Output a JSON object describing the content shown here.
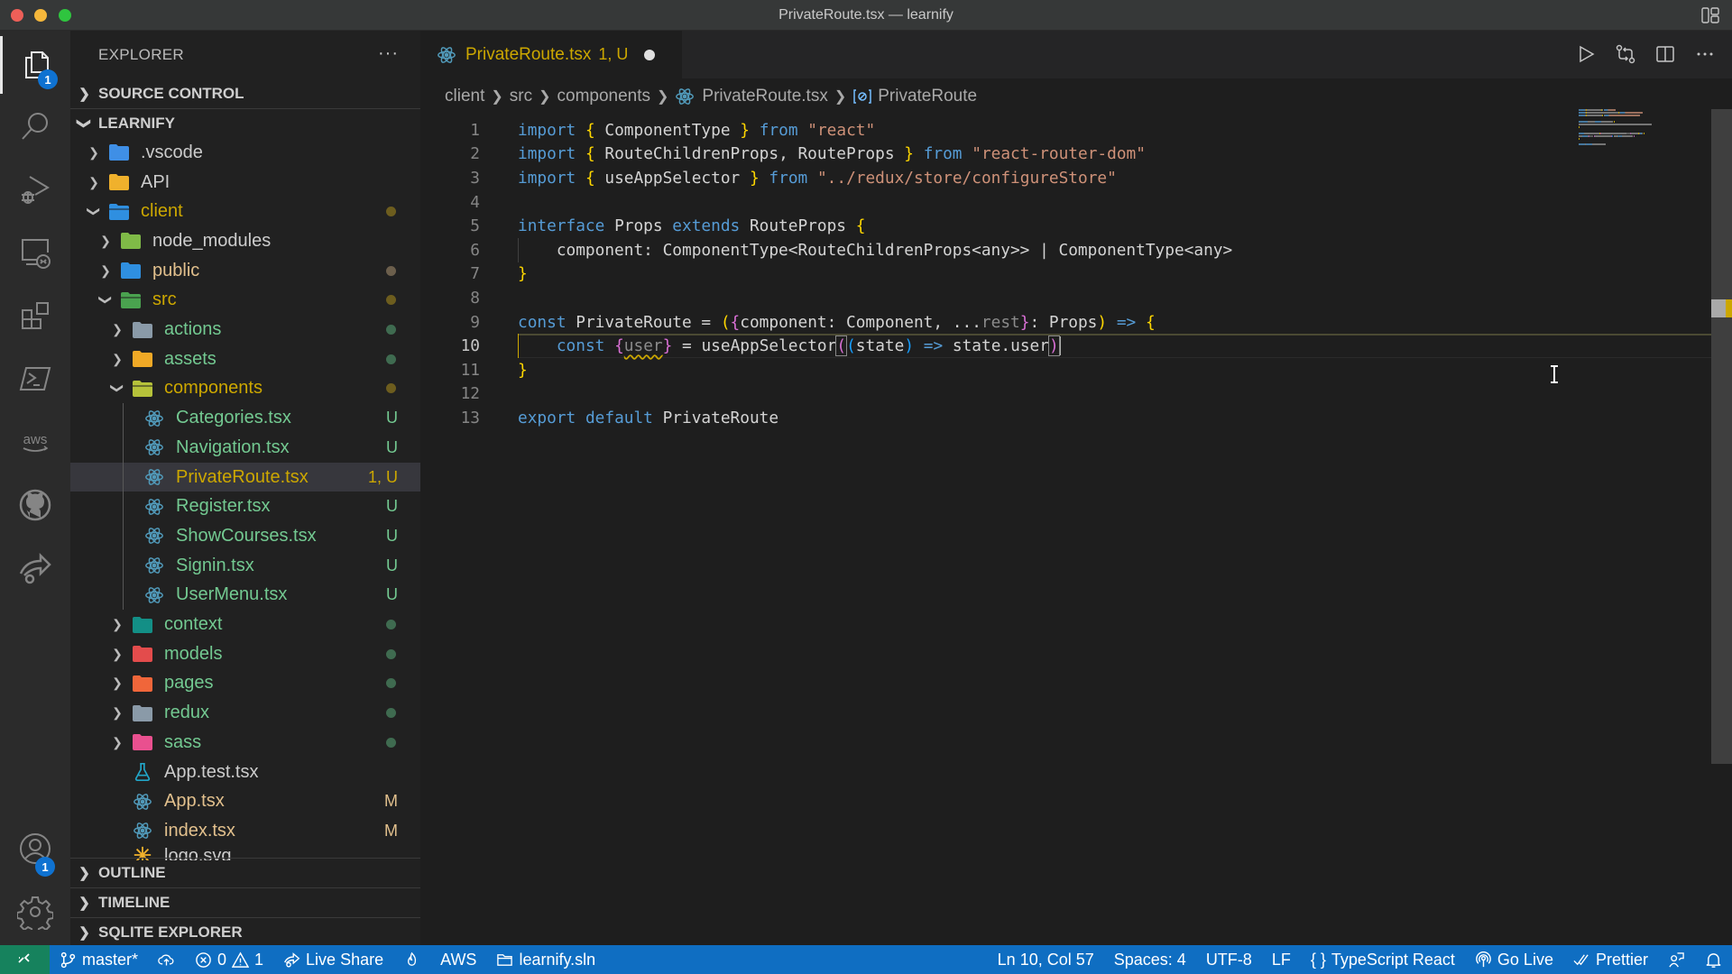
{
  "window": {
    "title": "PrivateRoute.tsx — learnify"
  },
  "activity_bar": {
    "items": [
      {
        "name": "explorer",
        "icon": "files-icon",
        "badge": "1",
        "active": true
      },
      {
        "name": "search",
        "icon": "search-icon"
      },
      {
        "name": "run-debug",
        "icon": "run-debug-icon"
      },
      {
        "name": "remote-explorer",
        "icon": "remote-explorer-icon"
      },
      {
        "name": "extensions",
        "icon": "extensions-icon"
      },
      {
        "name": "powershell",
        "icon": "terminal-icon"
      },
      {
        "name": "aws",
        "icon": "aws-icon",
        "text": "aws"
      },
      {
        "name": "github",
        "icon": "github-icon"
      },
      {
        "name": "live-share",
        "icon": "live-share-icon"
      }
    ],
    "accounts_badge": "1"
  },
  "sidebar": {
    "title": "EXPLORER",
    "more": "···",
    "sections": {
      "source_control": "SOURCE CONTROL",
      "workspace": "LEARNIFY",
      "outline": "OUTLINE",
      "timeline": "TIMELINE",
      "sqlite": "SQLITE EXPLORER"
    },
    "tree": [
      {
        "label": ".vscode",
        "type": "folder",
        "expanded": false,
        "depth": 0,
        "icon": "vscode-folder-icon",
        "color": "#cccccc",
        "decoration": ""
      },
      {
        "label": "API",
        "type": "folder",
        "expanded": false,
        "depth": 0,
        "icon": "api-folder-icon",
        "color": "#cccccc",
        "decoration": ""
      },
      {
        "label": "client",
        "type": "folder",
        "expanded": true,
        "depth": 0,
        "icon": "client-folder-icon",
        "color": "#cca700",
        "decoration": "dot-yellow"
      },
      {
        "label": "node_modules",
        "type": "folder",
        "expanded": false,
        "depth": 1,
        "icon": "node-folder-icon",
        "color": "#cccccc",
        "decoration": ""
      },
      {
        "label": "public",
        "type": "folder",
        "expanded": false,
        "depth": 1,
        "icon": "public-folder-icon",
        "color": "#e2c08d",
        "decoration": "dot-brown"
      },
      {
        "label": "src",
        "type": "folder",
        "expanded": true,
        "depth": 1,
        "icon": "src-folder-icon",
        "color": "#cca700",
        "decoration": "dot-yellow"
      },
      {
        "label": "actions",
        "type": "folder",
        "expanded": false,
        "depth": 2,
        "icon": "actions-folder-icon",
        "color": "#73c991",
        "decoration": "dot-green"
      },
      {
        "label": "assets",
        "type": "folder",
        "expanded": false,
        "depth": 2,
        "icon": "assets-folder-icon",
        "color": "#73c991",
        "decoration": "dot-green"
      },
      {
        "label": "components",
        "type": "folder",
        "expanded": true,
        "depth": 2,
        "icon": "components-folder-icon",
        "color": "#cca700",
        "decoration": "dot-yellow"
      },
      {
        "label": "Categories.tsx",
        "type": "file",
        "depth": 3,
        "icon": "react-icon",
        "color": "#73c991",
        "decoration": "U"
      },
      {
        "label": "Navigation.tsx",
        "type": "file",
        "depth": 3,
        "icon": "react-icon",
        "color": "#73c991",
        "decoration": "U"
      },
      {
        "label": "PrivateRoute.tsx",
        "type": "file",
        "depth": 3,
        "icon": "react-icon",
        "color": "#cca700",
        "decoration": "1, U",
        "selected": true
      },
      {
        "label": "Register.tsx",
        "type": "file",
        "depth": 3,
        "icon": "react-icon",
        "color": "#73c991",
        "decoration": "U"
      },
      {
        "label": "ShowCourses.tsx",
        "type": "file",
        "depth": 3,
        "icon": "react-icon",
        "color": "#73c991",
        "decoration": "U"
      },
      {
        "label": "Signin.tsx",
        "type": "file",
        "depth": 3,
        "icon": "react-icon",
        "color": "#73c991",
        "decoration": "U"
      },
      {
        "label": "UserMenu.tsx",
        "type": "file",
        "depth": 3,
        "icon": "react-icon",
        "color": "#73c991",
        "decoration": "U"
      },
      {
        "label": "context",
        "type": "folder",
        "expanded": false,
        "depth": 2,
        "icon": "context-folder-icon",
        "color": "#73c991",
        "decoration": "dot-green"
      },
      {
        "label": "models",
        "type": "folder",
        "expanded": false,
        "depth": 2,
        "icon": "models-folder-icon",
        "color": "#73c991",
        "decoration": "dot-green"
      },
      {
        "label": "pages",
        "type": "folder",
        "expanded": false,
        "depth": 2,
        "icon": "pages-folder-icon",
        "color": "#73c991",
        "decoration": "dot-green"
      },
      {
        "label": "redux",
        "type": "folder",
        "expanded": false,
        "depth": 2,
        "icon": "redux-folder-icon",
        "color": "#73c991",
        "decoration": "dot-green"
      },
      {
        "label": "sass",
        "type": "folder",
        "expanded": false,
        "depth": 2,
        "icon": "sass-folder-icon",
        "color": "#73c991",
        "decoration": "dot-green"
      },
      {
        "label": "App.test.tsx",
        "type": "file",
        "depth": 2,
        "icon": "test-flask-icon",
        "color": "#cccccc",
        "decoration": ""
      },
      {
        "label": "App.tsx",
        "type": "file",
        "depth": 2,
        "icon": "react-icon",
        "color": "#e2c08d",
        "decoration": "M"
      },
      {
        "label": "index.tsx",
        "type": "file",
        "depth": 2,
        "icon": "react-icon",
        "color": "#e2c08d",
        "decoration": "M"
      },
      {
        "label": "logo.svg",
        "type": "file",
        "depth": 2,
        "icon": "svg-icon",
        "color": "#cccccc",
        "decoration": "",
        "partial": true
      }
    ]
  },
  "editor": {
    "tab": {
      "label": "PrivateRoute.tsx",
      "decoration": "1, U",
      "dirty": true
    },
    "breadcrumbs": [
      "client",
      "src",
      "components",
      "PrivateRoute.tsx",
      "PrivateRoute"
    ],
    "current_line": 10,
    "lines": [
      {
        "n": "1",
        "tokens": [
          [
            "k",
            "import"
          ],
          [
            "p",
            " "
          ],
          [
            "b1",
            "{"
          ],
          [
            "p",
            " ComponentType "
          ],
          [
            "b1",
            "}"
          ],
          [
            "p",
            " "
          ],
          [
            "k",
            "from"
          ],
          [
            "p",
            " "
          ],
          [
            "s",
            "\"react\""
          ]
        ]
      },
      {
        "n": "2",
        "tokens": [
          [
            "k",
            "import"
          ],
          [
            "p",
            " "
          ],
          [
            "b1",
            "{"
          ],
          [
            "p",
            " RouteChildrenProps, RouteProps "
          ],
          [
            "b1",
            "}"
          ],
          [
            "p",
            " "
          ],
          [
            "k",
            "from"
          ],
          [
            "p",
            " "
          ],
          [
            "s",
            "\"react-router-dom\""
          ]
        ]
      },
      {
        "n": "3",
        "tokens": [
          [
            "k",
            "import"
          ],
          [
            "p",
            " "
          ],
          [
            "b1",
            "{"
          ],
          [
            "p",
            " useAppSelector "
          ],
          [
            "b1",
            "}"
          ],
          [
            "p",
            " "
          ],
          [
            "k",
            "from"
          ],
          [
            "p",
            " "
          ],
          [
            "s",
            "\"../redux/store/configureStore\""
          ]
        ]
      },
      {
        "n": "4",
        "tokens": []
      },
      {
        "n": "5",
        "tokens": [
          [
            "k",
            "interface"
          ],
          [
            "p",
            " Props "
          ],
          [
            "k",
            "extends"
          ],
          [
            "p",
            " RouteProps "
          ],
          [
            "b1",
            "{"
          ]
        ]
      },
      {
        "n": "6",
        "tokens": [
          [
            "p",
            "    component: ComponentType<RouteChildrenProps<any>> | ComponentType<any>"
          ]
        ]
      },
      {
        "n": "7",
        "tokens": [
          [
            "b1",
            "}"
          ]
        ]
      },
      {
        "n": "8",
        "tokens": []
      },
      {
        "n": "9",
        "tokens": [
          [
            "k",
            "const"
          ],
          [
            "p",
            " PrivateRoute = "
          ],
          [
            "b1",
            "("
          ],
          [
            "b2",
            "{"
          ],
          [
            "p",
            "component: Component, ..."
          ],
          [
            "dim",
            "rest"
          ],
          [
            "b2",
            "}"
          ],
          [
            "p",
            ": Props"
          ],
          [
            "b1",
            ")"
          ],
          [
            "p",
            " "
          ],
          [
            "k",
            "=>"
          ],
          [
            "p",
            " "
          ],
          [
            "b1",
            "{"
          ]
        ]
      },
      {
        "n": "10",
        "tokens": [
          [
            "p",
            "    "
          ],
          [
            "k",
            "const"
          ],
          [
            "p",
            " "
          ],
          [
            "b2",
            "{"
          ],
          [
            "dimsq",
            "user"
          ],
          [
            "b2",
            "}"
          ],
          [
            "p",
            " = useAppSelector"
          ],
          [
            "b2box",
            "("
          ],
          [
            "b3",
            "("
          ],
          [
            "p",
            "state"
          ],
          [
            "b3",
            ")"
          ],
          [
            "p",
            " "
          ],
          [
            "k",
            "=>"
          ],
          [
            "p",
            " state.user"
          ],
          [
            "b2box",
            ")"
          ],
          [
            "cursor",
            ""
          ]
        ]
      },
      {
        "n": "11",
        "tokens": [
          [
            "b1",
            "}"
          ]
        ]
      },
      {
        "n": "12",
        "tokens": []
      },
      {
        "n": "13",
        "tokens": [
          [
            "k",
            "export"
          ],
          [
            "p",
            " "
          ],
          [
            "k",
            "default"
          ],
          [
            "p",
            " PrivateRoute"
          ]
        ]
      }
    ]
  },
  "status_bar": {
    "branch": "master*",
    "errors": "0",
    "warnings": "1",
    "live_share": "Live Share",
    "aws": "AWS",
    "solution": "learnify.sln",
    "position": "Ln 10, Col 57",
    "spaces": "Spaces: 4",
    "encoding": "UTF-8",
    "eol": "LF",
    "language": "TypeScript React",
    "go_live": "Go Live",
    "prettier": "Prettier"
  },
  "colors": {
    "status_bar": "#0f6ec2",
    "remote": "#16825d",
    "modified_yellow": "#cca700",
    "untracked_green": "#73c991",
    "badge_blue": "#0f72d1"
  }
}
